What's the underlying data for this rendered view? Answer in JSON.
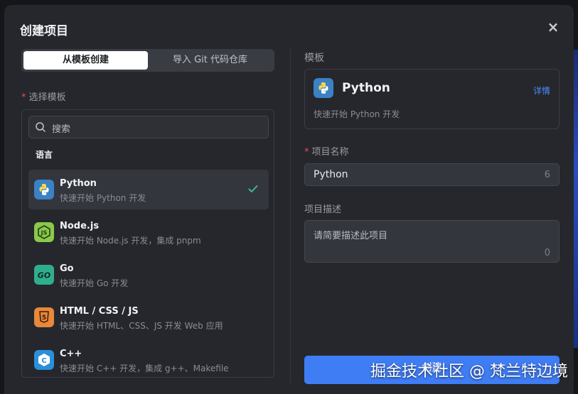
{
  "dialog": {
    "title": "创建项目",
    "close": "×"
  },
  "tabs": [
    {
      "label": "从模板创建",
      "active": true
    },
    {
      "label": "导入 Git 代码仓库",
      "active": false
    }
  ],
  "template_select": {
    "label": "选择模板",
    "required_mark": "*",
    "search_placeholder": "搜索",
    "group": "语言",
    "items": [
      {
        "name": "Python",
        "desc": "快速开始 Python 开发",
        "icon": "python-icon",
        "color": "#3b82c4",
        "selected": true
      },
      {
        "name": "Node.js",
        "desc": "快速开始 Node.js 开发，集成 pnpm",
        "icon": "nodejs-icon",
        "color": "#5fa04e",
        "selected": false
      },
      {
        "name": "Go",
        "desc": "快速开始 Go 开发",
        "icon": "go-icon",
        "color": "#2fae8e",
        "selected": false
      },
      {
        "name": "HTML / CSS / JS",
        "desc": "快速开始 HTML、CSS、JS 开发 Web 应用",
        "icon": "html5-icon",
        "color": "#e8883a",
        "selected": false
      },
      {
        "name": "C++",
        "desc": "快速开始 C++ 开发，集成 g++、Makefile",
        "icon": "cpp-icon",
        "color": "#2b8fd9",
        "selected": false
      }
    ]
  },
  "template_card": {
    "section_label": "模板",
    "title": "Python",
    "link": "详情",
    "desc": "快速开始 Python 开发"
  },
  "project_name": {
    "label": "项目名称",
    "required_mark": "*",
    "value": "Python",
    "count": "6"
  },
  "project_desc": {
    "label": "项目描述",
    "placeholder": "请简要描述此项目",
    "count": "0"
  },
  "submit": {
    "label": "创建"
  },
  "watermark": "掘金技术社区 @ 梵兰特边境",
  "colors": {
    "accent": "#3f7df5",
    "link": "#4c8dff",
    "check": "#3fb98a",
    "required": "#e5484d"
  }
}
